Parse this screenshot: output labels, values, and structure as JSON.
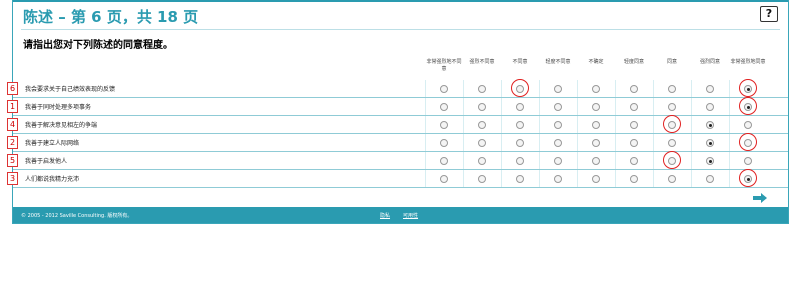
{
  "header": {
    "title": "陈述 – 第 6 页，共 18 页",
    "help_label": "?"
  },
  "instruction": "请指出您对下列陈述的同意程度。",
  "scale": [
    "非常强烈地不同意",
    "强烈不同意",
    "不同意",
    "轻度不同意",
    "不确定",
    "轻度同意",
    "同意",
    "强烈同意",
    "非常强烈地同意"
  ],
  "statements": [
    {
      "num": "6",
      "text": "我会要求关于自己绩效表现的反馈",
      "selected": 8
    },
    {
      "num": "1",
      "text": "我善于同时处理多项事务",
      "selected": 8
    },
    {
      "num": "4",
      "text": "我善于解决意见相左的争端",
      "selected": 7
    },
    {
      "num": "2",
      "text": "我善于建立人际网络",
      "selected": 7
    },
    {
      "num": "5",
      "text": "我善于启发他人",
      "selected": 7
    },
    {
      "num": "3",
      "text": "人们都说我精力充沛",
      "selected": 8
    }
  ],
  "footer": {
    "copyright": "© 2005 - 2012 Saville Consulting. 版权所有。",
    "privacy": "隐私",
    "terms": "可用性"
  },
  "colors": {
    "accent": "#2a9bb0",
    "annotation": "#e02020"
  }
}
